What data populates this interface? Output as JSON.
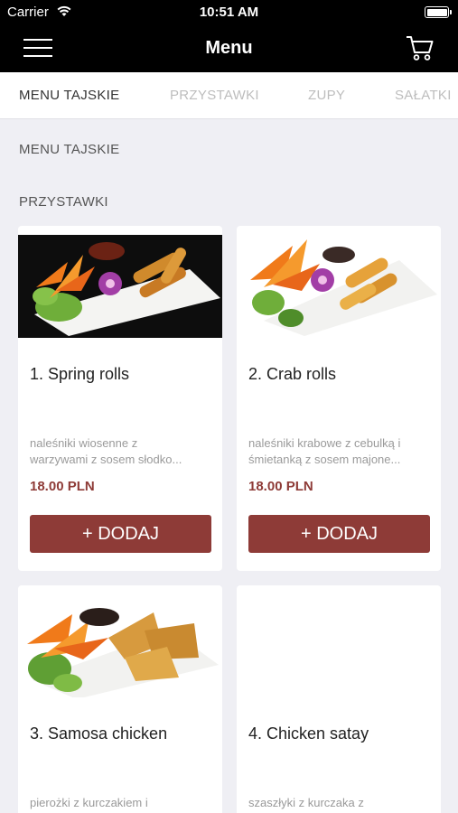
{
  "status_bar": {
    "carrier": "Carrier",
    "time": "10:51 AM"
  },
  "nav": {
    "title": "Menu",
    "menu_icon": "hamburger-icon",
    "cart_icon": "cart-icon"
  },
  "tabs": [
    {
      "label": "MENU TAJSKIE",
      "active": true
    },
    {
      "label": "PRZYSTAWKI",
      "active": false
    },
    {
      "label": "ZUPY",
      "active": false
    },
    {
      "label": "SAŁATKI",
      "active": false
    }
  ],
  "section": {
    "category": "MENU TAJSKIE",
    "subcategory": "PRZYSTAWKI"
  },
  "items": [
    {
      "name": "1. Spring rolls",
      "desc_line1": "naleśniki wiosenne z",
      "desc_line2": "warzywami z sosem słodko...",
      "price": "18.00 PLN",
      "button": "+ DODAJ"
    },
    {
      "name": "2. Crab rolls",
      "desc_line1": "naleśniki krabowe z cebulką i",
      "desc_line2": "śmietanką z sosem majone...",
      "price": "18.00 PLN",
      "button": "+ DODAJ"
    },
    {
      "name": "3. Samosa chicken",
      "desc_line1": "pierożki z kurczakiem i",
      "desc_line2": ""
    },
    {
      "name": "4. Chicken satay",
      "desc_line1": "szaszłyki z kurczaka z",
      "desc_line2": ""
    }
  ],
  "colors": {
    "accent": "#8e3b37",
    "navbar": "#000000",
    "background": "#efeff4"
  }
}
